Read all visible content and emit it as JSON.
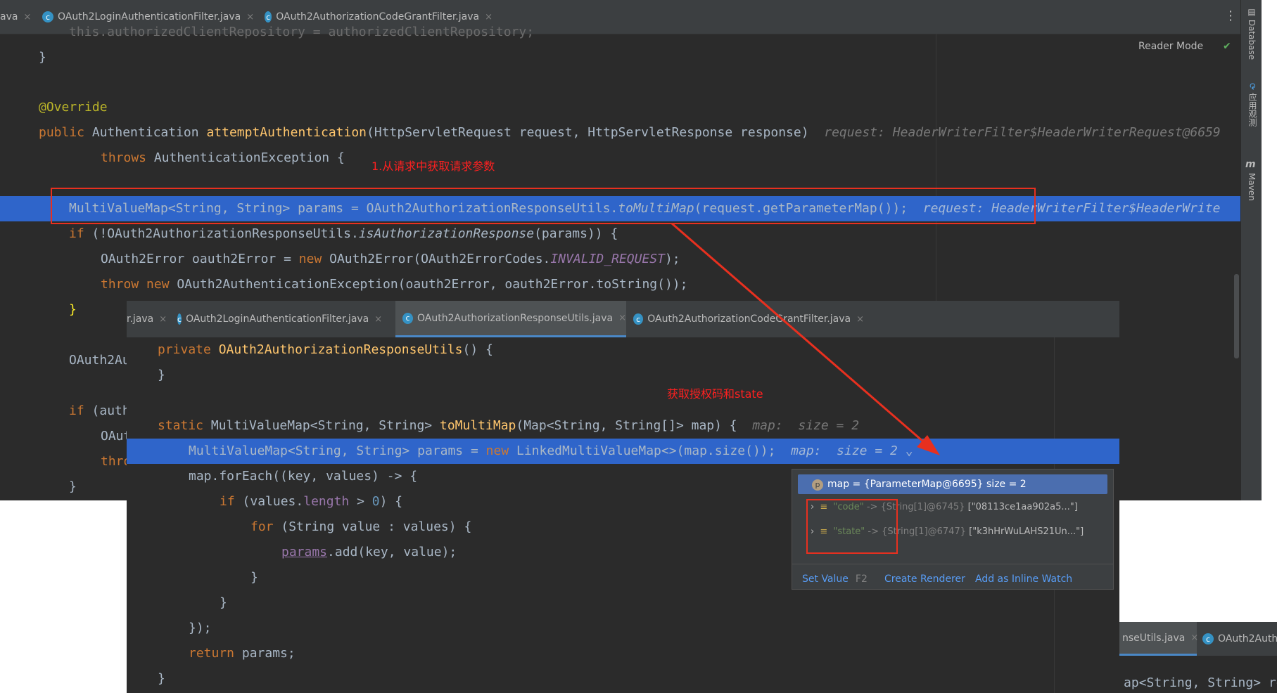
{
  "main_tabs": [
    {
      "label": "ava",
      "icon": "none"
    },
    {
      "label": "OAuth2LoginAuthenticationFilter.java",
      "icon": "class-icon"
    },
    {
      "label": "OAuth2AuthorizationCodeGrantFilter.java",
      "icon": "class-icon"
    }
  ],
  "reader_mode_label": "Reader Mode",
  "right_tools": {
    "database": "Database",
    "app_service": "应用观测",
    "maven": "Maven",
    "maven_glyph": "m"
  },
  "code": {
    "l0": "this.authorizedClientRepository = authorizedClientRepository;",
    "l1": "}",
    "l3": "@Override",
    "l4_kw": "public",
    "l4_type": "Authentication",
    "l4_fn": "attemptAuthentication",
    "l4_params": "(HttpServletRequest request, HttpServletResponse response)",
    "l4_hint": "request: HeaderWriterFilter$HeaderWriterRequest@6659",
    "l5_kw": "throws",
    "l5_rest": "AuthenticationException {",
    "l7_code": "MultiValueMap<String, String> params = OAuth2AuthorizationResponseUtils.",
    "l7_method": "toMultiMap",
    "l7_rest": "(request.getParameterMap());",
    "l7_hint": "request: HeaderWriterFilter$HeaderWrite",
    "l8_kw": "if",
    "l8_a": "(!OAuth2AuthorizationResponseUtils.",
    "l8_method": "isAuthorizationResponse",
    "l8_b": "(params)) {",
    "l9_a": "OAuth2Error oauth2Error = ",
    "l9_kw": "new",
    "l9_b": " OAuth2Error(OAuth2ErrorCodes.",
    "l9_const": "INVALID_REQUEST",
    "l9_c": ");",
    "l10_kw1": "throw",
    "l10_kw2": "new",
    "l10_rest": "OAuth2AuthenticationException(oauth2Error, oauth2Error.toString());",
    "l11": "}",
    "l13": "OAuth2Au",
    "l15_kw": "if",
    "l15_rest": "(auth",
    "l16": "OAut",
    "l17": "thro",
    "l18": "}"
  },
  "annotation_1": "1.从请求中获取请求参数",
  "annotation_2": "获取授权码和state",
  "popup_tabs": [
    {
      "label": "r.java",
      "icon": "none"
    },
    {
      "label": "OAuth2LoginAuthenticationFilter.java",
      "icon": "class-icon"
    },
    {
      "label": "OAuth2AuthorizationResponseUtils.java",
      "icon": "class-icon",
      "active": true
    },
    {
      "label": "OAuth2AuthorizationCodeGrantFilter.java",
      "icon": "class-icon"
    }
  ],
  "popup_code": {
    "p0_kw": "private",
    "p0_fn": "OAuth2AuthorizationResponseUtils",
    "p0_rest": "() {",
    "p1": "}",
    "p3_kw": "static",
    "p3_a": "MultiValueMap<String, String>",
    "p3_fn": "toMultiMap",
    "p3_b": "(Map<String, String[]> map) {",
    "p3_hint": "map:  size = 2",
    "p4_a": "MultiValueMap<String, String> params = ",
    "p4_kw": "new",
    "p4_b": " LinkedMultiValueMap<>(map.size());",
    "p4_hint": "map:  size = 2",
    "p5": "map.forEach((key, values) -> {",
    "p6_kw": "if",
    "p6_a": "(values.",
    "p6_field": "length",
    "p6_b": " > ",
    "p6_num": "0",
    "p6_c": ") {",
    "p7_kw": "for",
    "p7_rest": "(String value : values) {",
    "p8_var": "params",
    "p8_rest": ".add(key, value);",
    "p9": "}",
    "p10": "}",
    "p11": "});",
    "p12_kw": "return",
    "p12_rest": "params;",
    "p13": "}"
  },
  "tooltip": {
    "root_badge": "p",
    "root": "map = {ParameterMap@6695}  size = 2",
    "entries": [
      {
        "key": "\"code\"",
        "arrow": "->",
        "type": "{String[1]@6745}",
        "value": "[\"08113ce1aa902a5...\"]"
      },
      {
        "key": "\"state\"",
        "arrow": "->",
        "type": "{String[1]@6747}",
        "value": "[\"k3hHrWuLAHS21Un...\"]"
      }
    ],
    "actions": {
      "set_value": "Set Value",
      "set_value_key": "F2",
      "create_renderer": "Create Renderer",
      "add_inline_watch": "Add as Inline Watch"
    }
  },
  "third_window": {
    "tab1": "nseUtils.java",
    "tab2": "OAuth2Auth",
    "code": "ap<String, String> re"
  }
}
